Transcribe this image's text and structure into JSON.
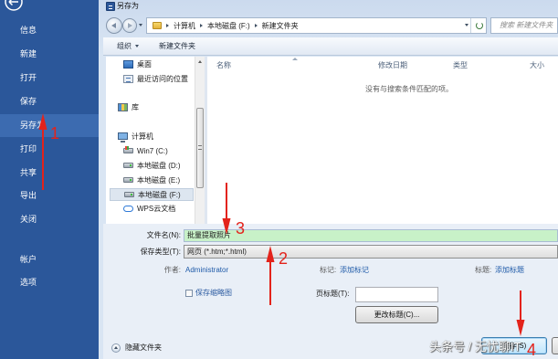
{
  "colors": {
    "sidebar_bg": "#2b579a",
    "sidebar_selected": "#3c6bb0",
    "annotation_red": "#e3231b",
    "filename_highlight": "#c8f1c8",
    "link_blue": "#1e5aa8"
  },
  "sidebar": {
    "back_icon": "back-arrow-icon",
    "items": [
      {
        "label": "信息"
      },
      {
        "label": "新建"
      },
      {
        "label": "打开"
      },
      {
        "label": "保存"
      },
      {
        "label": "另存为",
        "selected": true
      },
      {
        "label": "打印"
      },
      {
        "label": "共享"
      },
      {
        "label": "导出"
      },
      {
        "label": "关闭"
      },
      {
        "label": "帐户"
      },
      {
        "label": "选项"
      }
    ]
  },
  "dialog": {
    "title": "另存为",
    "title_icon": "word-icon",
    "address": {
      "segments": [
        "计算机",
        "本地磁盘 (F:)",
        "新建文件夹"
      ]
    },
    "search_placeholder": "搜索 新建文件夹",
    "toolbar": {
      "organize": "组织",
      "new_folder": "新建文件夹"
    },
    "nav": [
      {
        "label": "桌面",
        "icon": "desktop-icon"
      },
      {
        "label": "最近访问的位置",
        "icon": "recent-places-icon"
      },
      {
        "label": "库",
        "icon": "library-icon"
      },
      {
        "label": "计算机",
        "icon": "computer-icon"
      },
      {
        "label": "Win7 (C:)",
        "icon": "system-drive-icon"
      },
      {
        "label": "本地磁盘 (D:)",
        "icon": "drive-icon"
      },
      {
        "label": "本地磁盘 (E:)",
        "icon": "drive-icon"
      },
      {
        "label": "本地磁盘 (F:)",
        "icon": "drive-icon",
        "selected": true
      },
      {
        "label": "WPS云文档",
        "icon": "cloud-icon"
      }
    ],
    "columns": [
      "名称",
      "修改日期",
      "类型",
      "大小"
    ],
    "empty_message": "没有与搜索条件匹配的项。",
    "form": {
      "filename_label": "文件名(N):",
      "filename_value": "批量提取照片",
      "filetype_label": "保存类型(T):",
      "filetype_value": "网页 (*.htm;*.html)",
      "author_label": "作者:",
      "author_value": "Administrator",
      "tags_label": "标记:",
      "tags_value": "添加标记",
      "title_label": "标题:",
      "title_value": "添加标题",
      "thumbnail_label": "保存缩略图",
      "thumbnail_checked": false,
      "page_title_label": "页标题(T):",
      "change_title_button": "更改标题(C)..."
    },
    "hide_folders": "隐藏文件夹",
    "save_button": "保存(S)"
  },
  "annotations": [
    "1",
    "2",
    "3",
    "4"
  ],
  "watermark": "头条号 / 无忧聊IT"
}
